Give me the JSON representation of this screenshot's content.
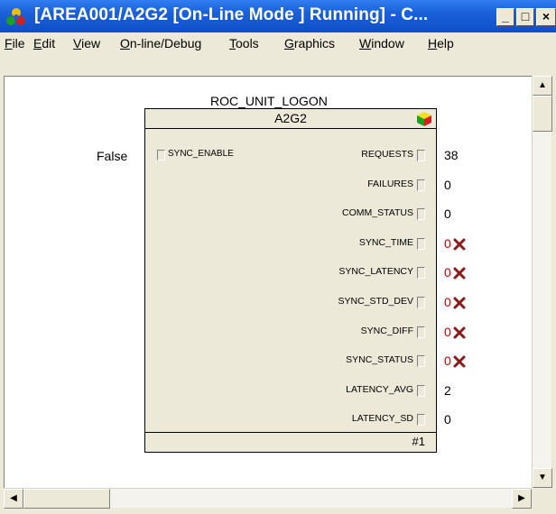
{
  "window": {
    "title": "[AREA001/A2G2 [On-Line Mode ] Running] - C...",
    "minimize": "_",
    "maximize": "□",
    "close": "×"
  },
  "menu": [
    {
      "label": "File",
      "accel": "F"
    },
    {
      "label": "Edit",
      "accel": "E"
    },
    {
      "label": "View",
      "accel": "V"
    },
    {
      "label": "On-line/Debug",
      "accel": "O"
    },
    {
      "label": "Tools",
      "accel": "T"
    },
    {
      "label": "Graphics",
      "accel": "G"
    },
    {
      "label": "Window",
      "accel": "W"
    },
    {
      "label": "Help",
      "accel": "H"
    }
  ],
  "block": {
    "type_name": "ROC_UNIT_LOGON",
    "instance_name": "A2G2",
    "footer": "#1",
    "icon": "colored-cube-icon",
    "input": {
      "name": "SYNC_ENABLE",
      "value": "False"
    },
    "outputs": [
      {
        "name": "REQUESTS",
        "value": "38",
        "error": false
      },
      {
        "name": "FAILURES",
        "value": "0",
        "error": false
      },
      {
        "name": "COMM_STATUS",
        "value": "0",
        "error": false
      },
      {
        "name": "SYNC_TIME",
        "value": "0",
        "error": true
      },
      {
        "name": "SYNC_LATENCY",
        "value": "0",
        "error": true
      },
      {
        "name": "SYNC_STD_DEV",
        "value": "0",
        "error": true
      },
      {
        "name": "SYNC_DIFF",
        "value": "0",
        "error": true
      },
      {
        "name": "SYNC_STATUS",
        "value": "0",
        "error": true
      },
      {
        "name": "LATENCY_AVG",
        "value": "2",
        "error": false
      },
      {
        "name": "LATENCY_SD",
        "value": "0",
        "error": false
      }
    ]
  },
  "colors": {
    "titlebar": "#0e4fc6",
    "error_value": "#c00000",
    "error_icon": "#8b1a1a"
  }
}
